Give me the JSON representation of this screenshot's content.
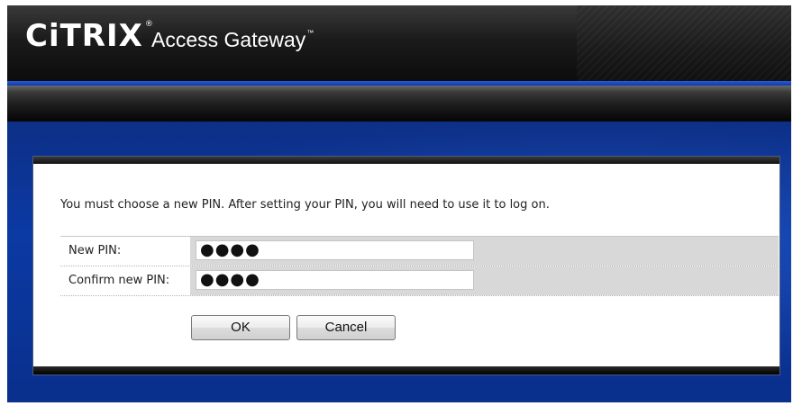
{
  "header": {
    "brand": "CiTRIX",
    "product": "Access Gateway",
    "trademark": "™",
    "registered": "®"
  },
  "dialog": {
    "instructions": "You must choose a new PIN. After setting your PIN, you will need to use it to log on.",
    "fields": [
      {
        "label": "New PIN:",
        "value": "●●●●",
        "type": "password"
      },
      {
        "label": "Confirm new PIN:",
        "value": "●●●●",
        "type": "password"
      }
    ],
    "buttons": {
      "ok_label": "OK",
      "cancel_label": "Cancel"
    }
  },
  "colors": {
    "header_black": "#1b1b1b",
    "accent_blue": "#0b3aa4",
    "field_gray": "#d8d8d8"
  }
}
